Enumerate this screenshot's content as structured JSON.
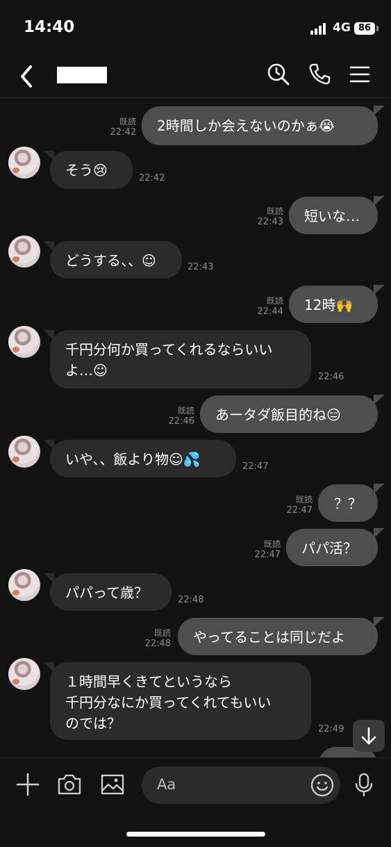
{
  "status": {
    "time": "14:40",
    "network": "4G",
    "battery": "86"
  },
  "header": {
    "icons": [
      "back-icon",
      "search-history-icon",
      "phone-icon",
      "menu-icon"
    ]
  },
  "messages": [
    {
      "side": "out",
      "text": "2時間しか会えないのかぁ😭",
      "read": "既読",
      "time": "22:42"
    },
    {
      "side": "in",
      "text": "そう😢",
      "time": "22:42"
    },
    {
      "side": "out",
      "text": "短いな…",
      "read": "既読",
      "time": "22:43"
    },
    {
      "side": "in",
      "text": "どうする、、☺",
      "time": "22:43"
    },
    {
      "side": "out",
      "text": "12時🙌",
      "read": "既読",
      "time": "22:44"
    },
    {
      "side": "in",
      "text": "千円分何か買ってくれるならいい\nよ…☺",
      "time": "22:46"
    },
    {
      "side": "out",
      "text": "あータダ飯目的ね😑",
      "read": "既読",
      "time": "22:46"
    },
    {
      "side": "in",
      "text": "いや、、飯より物☺💦",
      "time": "22:47"
    },
    {
      "side": "out",
      "text": "？？",
      "read": "既読",
      "time": "22:47"
    },
    {
      "side": "out",
      "text": "パパ活？",
      "read": "既読",
      "time": "22:47"
    },
    {
      "side": "in",
      "text": "パパって歳？",
      "time": "22:48"
    },
    {
      "side": "out",
      "text": "やってることは同じだよ",
      "read": "既読",
      "time": "22:48"
    },
    {
      "side": "in",
      "text": "１時間早くきてというなら\n千円分なにか買ってくれてもいい\nのでは？",
      "time": "22:49"
    }
  ],
  "input": {
    "placeholder": "Aa"
  },
  "icons": {
    "scroll_down": "arrow-down-icon",
    "plus": "plus-icon",
    "camera": "camera-icon",
    "image": "image-icon",
    "emoji": "emoji-icon",
    "mic": "mic-icon"
  }
}
